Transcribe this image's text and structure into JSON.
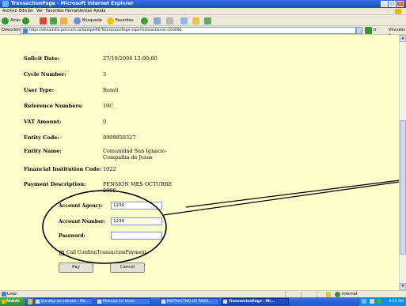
{
  "window": {
    "title": "TransactionPage - Microsoft Internet Explorer",
    "controls": [
      "_",
      "□",
      "x"
    ]
  },
  "menu": {
    "items": [
      "Archivo",
      "Edición",
      "Ver",
      "Favoritos",
      "Herramientas",
      "Ayuda"
    ]
  },
  "toolbar": {
    "back_label": "Atrás",
    "search_label": "Búsqueda",
    "favorites_label": "Favoritos"
  },
  "address": {
    "label": "Dirección",
    "url": "https://desarrollo.pse.com.co/SamplePE/TransactionPage.aspx?transactionId=103092",
    "go_label": "Ir",
    "links_label": "Vínculos »"
  },
  "details": [
    {
      "label": "Solicit Date:",
      "value": "27/10/2006 12:00:00"
    },
    {
      "label": "Cycle Number:",
      "value": "3"
    },
    {
      "label": "User Type:",
      "value": "Item0"
    },
    {
      "label": "Reference Numbers:",
      "value": "10C_"
    },
    {
      "label": "VAT Amount:",
      "value": "0"
    },
    {
      "label": "Entity Code:",
      "value": "8909858327"
    },
    {
      "label": "Entity Name:",
      "value": "Comunidad San Ignacio-",
      "value2": "Compañia de Jesus"
    },
    {
      "label": "Financial Institution Code:",
      "value": "1022"
    },
    {
      "label": "Payment Description:",
      "value": "PENSION MES OCTUBRE",
      "value2": "2006"
    }
  ],
  "form": {
    "agency_label": "Account Agency:",
    "agency_value": "1234",
    "number_label": "Account Number:",
    "number_value": "1234",
    "password_label": "Password:",
    "password_value": "",
    "checkbox_label": "Call ConfirmTransactionPayment",
    "checkbox_mark": "✔",
    "pay_label": "Pay",
    "cancel_label": "Cancel"
  },
  "status": {
    "text": "Listo",
    "zone": "Internet"
  },
  "taskbar": {
    "start_label": "Inicio",
    "tasks": [
      "Bandeja de entrada - Mic...",
      "Mensaje sin título",
      "INSTRUCTIVO DE PAGO...",
      "TransactionPage - Mi..."
    ],
    "clock": "8:52 AM"
  },
  "colors": {
    "content_bg": "#ffffcc",
    "chrome_bg": "#ece9d8",
    "taskbar_blue": "#2355cc"
  }
}
